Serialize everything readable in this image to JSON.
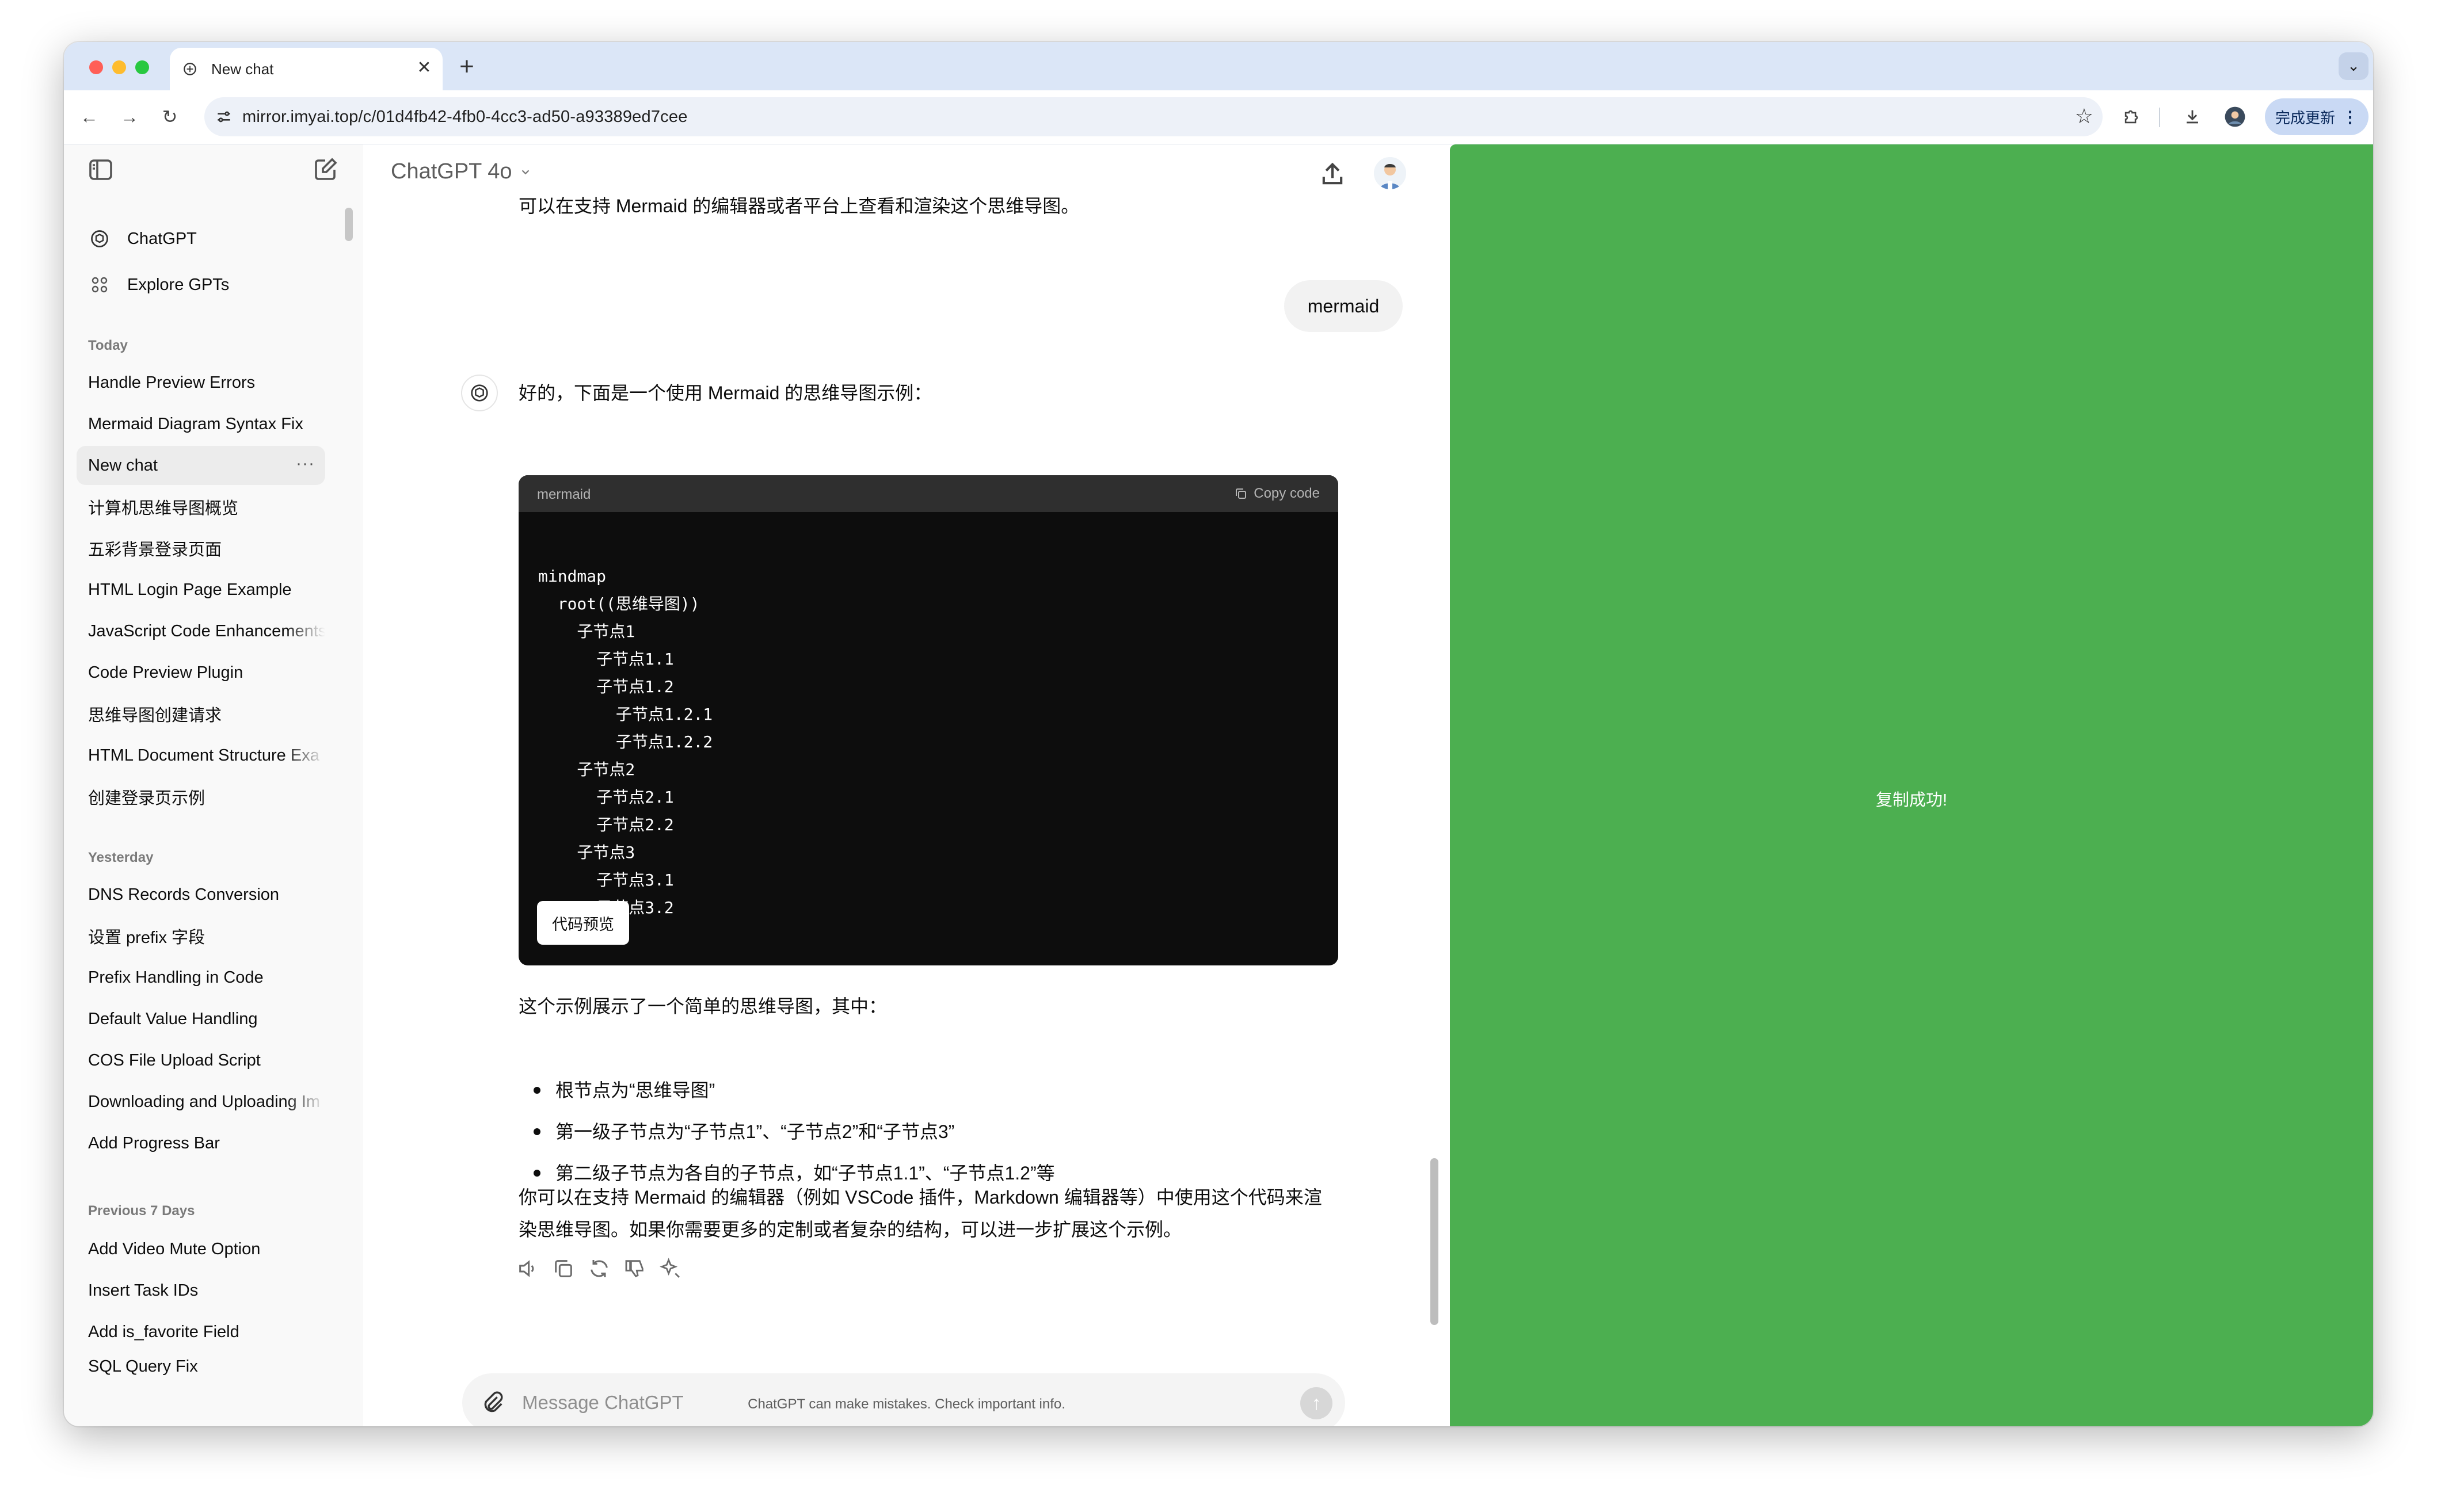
{
  "browser": {
    "tab_title": "New chat",
    "url": "mirror.imyai.top/c/01d4fb42-4fb0-4cc3-ad50-a93389ed7cee",
    "update_button": "完成更新"
  },
  "sidebar": {
    "nav": [
      {
        "label": "ChatGPT",
        "icon": "chatgpt-logo-icon"
      },
      {
        "label": "Explore GPTs",
        "icon": "grid-icon"
      }
    ],
    "sections": [
      {
        "heading": "Today",
        "items": [
          "Handle Preview Errors",
          "Mermaid Diagram Syntax Fix",
          "New chat",
          "计算机思维导图概览",
          "五彩背景登录页面",
          "HTML Login Page Example",
          "JavaScript Code Enhancements",
          "Code Preview Plugin",
          "思维导图创建请求",
          "HTML Document Structure Exa",
          "创建登录页示例"
        ]
      },
      {
        "heading": "Yesterday",
        "items": [
          "DNS Records Conversion",
          "设置 prefix 字段",
          "Prefix Handling in Code",
          "Default Value Handling",
          "COS File Upload Script",
          "Downloading and Uploading Im",
          "Add Progress Bar"
        ]
      },
      {
        "heading": "Previous 7 Days",
        "items": [
          "Add Video Mute Option",
          "Insert Task IDs",
          "Add is_favorite Field",
          "SQL Query Fix"
        ]
      }
    ],
    "active_item": "New chat",
    "active_item_more": "···"
  },
  "chat": {
    "model_label": "ChatGPT 4o",
    "prev_text": "可以在支持 Mermaid 的编辑器或者平台上查看和渲染这个思维导图。",
    "user_message": "mermaid",
    "reply_intro": "好的，下面是一个使用 Mermaid 的思维导图示例：",
    "code_block": {
      "language": "mermaid",
      "copy_label": "Copy code",
      "lines": [
        "mindmap",
        "  root((思维导图))",
        "    子节点1",
        "      子节点1.1",
        "      子节点1.2",
        "        子节点1.2.1",
        "        子节点1.2.2",
        "    子节点2",
        "      子节点2.1",
        "      子节点2.2",
        "    子节点3",
        "      子节点3.1",
        "      子节点3.2"
      ],
      "preview_button": "代码预览"
    },
    "explain": "这个示例展示了一个简单的思维导图，其中：",
    "bullets": [
      "根节点为“思维导图”",
      "第一级子节点为“子节点1”、“子节点2”和“子节点3”",
      "第二级子节点为各自的子节点，如“子节点1.1”、“子节点1.2”等"
    ],
    "outro_line1": "你可以在支持 Mermaid 的编辑器（例如 VSCode 插件，Markdown 编辑器等）中使用这个代码来渲",
    "outro_line2": "染思维导图。如果你需要更多的定制或者复杂的结构，可以进一步扩展这个示例。",
    "composer_placeholder": "Message ChatGPT",
    "disclaimer": "ChatGPT can make mistakes. Check important info."
  },
  "preview_panel": {
    "background": "#4caf50",
    "toast": "复制成功!"
  }
}
